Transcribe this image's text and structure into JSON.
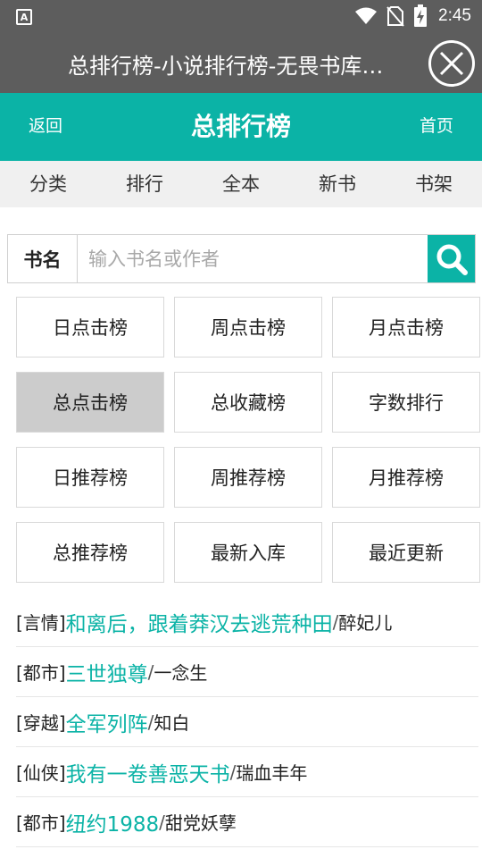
{
  "status_bar": {
    "app_badge": "A",
    "time": "2:45",
    "icons": [
      "wifi-icon",
      "no-sim-icon",
      "battery-charging-icon"
    ]
  },
  "title_bar": {
    "title": "总排行榜-小说排行榜-无畏书库…"
  },
  "header": {
    "back_label": "返回",
    "title": "总排行榜",
    "home_label": "首页",
    "accent_color": "#0bb3a6"
  },
  "nav": {
    "items": [
      "分类",
      "排行",
      "全本",
      "新书",
      "书架"
    ]
  },
  "search": {
    "label": "书名",
    "placeholder": "输入书名或作者",
    "value": ""
  },
  "rank_grid": {
    "cells": [
      "日点击榜",
      "周点击榜",
      "月点击榜",
      "总点击榜",
      "总收藏榜",
      "字数排行",
      "日推荐榜",
      "周推荐榜",
      "月推荐榜",
      "总推荐榜",
      "最新入库",
      "最近更新"
    ],
    "active": "总点击榜"
  },
  "book_list": [
    {
      "category": "[言情]",
      "title": "和离后，跟着莽汉去逃荒种田",
      "author": "醉妃儿"
    },
    {
      "category": "[都市]",
      "title": "三世独尊",
      "author": "一念生"
    },
    {
      "category": "[穿越]",
      "title": "全军列阵",
      "author": "知白"
    },
    {
      "category": "[仙侠]",
      "title": "我有一卷善恶天书",
      "author": "瑞血丰年"
    },
    {
      "category": "[都市]",
      "title": "纽约1988",
      "author": "甜党妖孽"
    }
  ]
}
